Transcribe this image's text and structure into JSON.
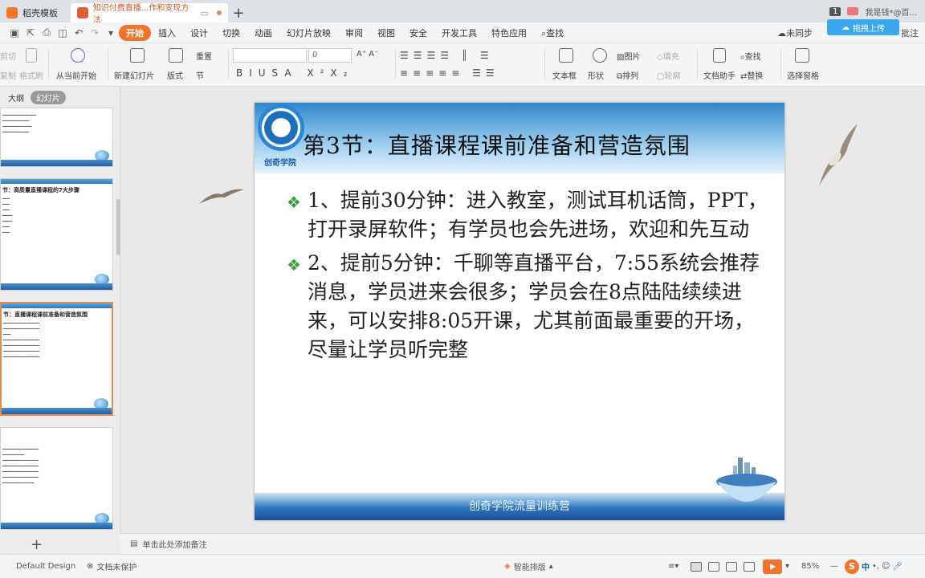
{
  "titlebar": {
    "tab1_label": "稻壳模板",
    "tab2_label": "知识付费直播...作和变现方法",
    "page_badge": "1",
    "user_label": "我是钱*@百..."
  },
  "menubar": {
    "items": [
      "开始",
      "插入",
      "设计",
      "切换",
      "动画",
      "幻灯片放映",
      "审阅",
      "视图",
      "安全",
      "开发工具",
      "特色应用"
    ],
    "search": "查找",
    "sync": "未同步",
    "upload": "拖拽上传",
    "share": "批注"
  },
  "ribbon": {
    "cut": "剪切",
    "copy": "复制",
    "format_painter": "格式刷",
    "from_current": "从当前开始",
    "new_slide": "新建幻灯片",
    "layout": "版式",
    "reset": "重置",
    "section": "节",
    "font_size": "0",
    "textbox": "文本框",
    "shape": "形状",
    "picture": "图片",
    "arrange": "排列",
    "fill": "填充",
    "outline": "轮廓",
    "doc_assistant": "文档助手",
    "find": "查找",
    "replace": "替换",
    "select_pane": "选择窗格"
  },
  "leftpanel": {
    "tab_outline": "大纲",
    "tab_slides": "幻灯片",
    "thumb2_title": "节：高质量直播课程的7大步骤",
    "thumb3_title": "节：直播课程课前准备和营造氛围",
    "add_label": "+"
  },
  "slide": {
    "logo_text": "创奇学院",
    "title": "第3节：直播课程课前准备和营造氛围",
    "bullet1": "1、提前30分钟：进入教室，测试耳机话筒，PPT，打开录屏软件；有学员也会先进场，欢迎和先互动",
    "bullet2": "2、提前5分钟：千聊等直播平台，7:55系统会推荐消息，学员进来会很多；学员会在8点陆陆续续进来，可以安排8:05开课，尤其前面最重要的开场，尽量让学员听完整",
    "footer": "创奇学院流量训练营"
  },
  "notes": {
    "placeholder": "单击此处添加备注"
  },
  "statusbar": {
    "design": "Default Design",
    "protect": "文档未保护",
    "smart": "智能排版",
    "zoom": "85%",
    "ime": "中"
  },
  "colors": {
    "accent": "#f2732a",
    "upload": "#3ba7ee"
  }
}
